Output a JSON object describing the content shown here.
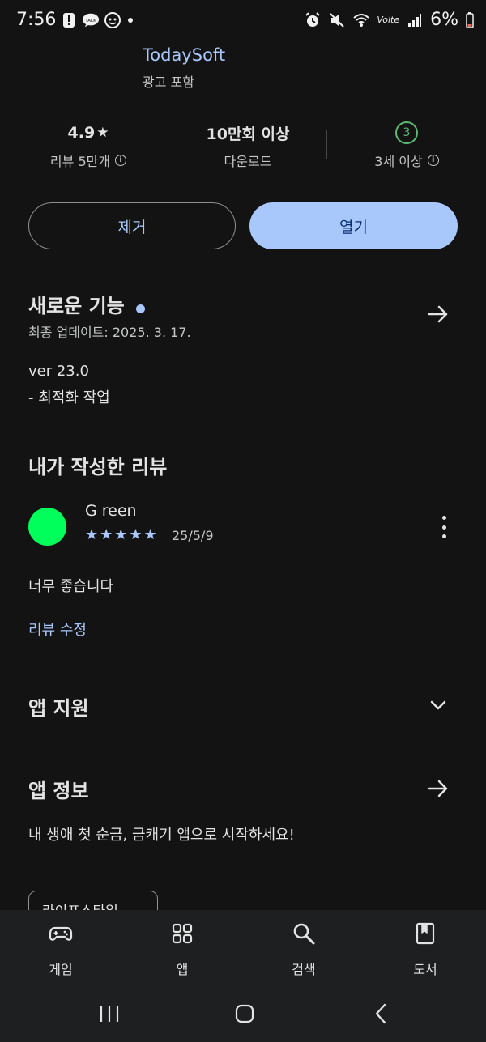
{
  "status_bar": {
    "time": "7:56",
    "battery": "6%",
    "icons_left": [
      "alert-icon",
      "talk-icon",
      "chat-icon",
      "dot-icon"
    ],
    "icons_right": [
      "alarm-icon",
      "mute-icon",
      "wifi-icon",
      "volte-icon",
      "signal-icon",
      "battery-icon"
    ],
    "volte_text": "Volte"
  },
  "app_header": {
    "developer": "TodaySoft",
    "ads": "광고 포함"
  },
  "stats": {
    "rating": {
      "value": "4.9",
      "star": "★",
      "label": "리뷰 5만개"
    },
    "downloads": {
      "value": "10만회 이상",
      "label": "다운로드"
    },
    "age": {
      "badge": "3",
      "label": "3세 이상"
    }
  },
  "buttons": {
    "remove_label": "제거",
    "open_label": "열기"
  },
  "whats_new": {
    "title": "새로운 기능",
    "last_updated": "최종 업데이트: 2025. 3. 17.",
    "version": "ver 23.0",
    "notes": "- 최적화 작업"
  },
  "my_review": {
    "title": "내가 작성한 리뷰",
    "reviewer": "G reen",
    "stars": 5,
    "date": "25/5/9",
    "text": "너무 좋습니다",
    "edit_label": "리뷰 수정"
  },
  "app_support": {
    "title": "앱 지원"
  },
  "app_info": {
    "title": "앱 정보",
    "description": "내 생애 첫 순금, 금캐기 앱으로 시작하세요!",
    "category_chip": "라이프스타일"
  },
  "bottom_nav": {
    "items": [
      {
        "label": "게임",
        "icon": "gamepad-icon"
      },
      {
        "label": "앱",
        "icon": "apps-grid-icon"
      },
      {
        "label": "검색",
        "icon": "search-icon"
      },
      {
        "label": "도서",
        "icon": "book-icon"
      }
    ]
  },
  "colors": {
    "background": "#131314",
    "accent": "#a8c7fa",
    "avatar": "#00ff5a",
    "age_badge": "#5bb974"
  }
}
